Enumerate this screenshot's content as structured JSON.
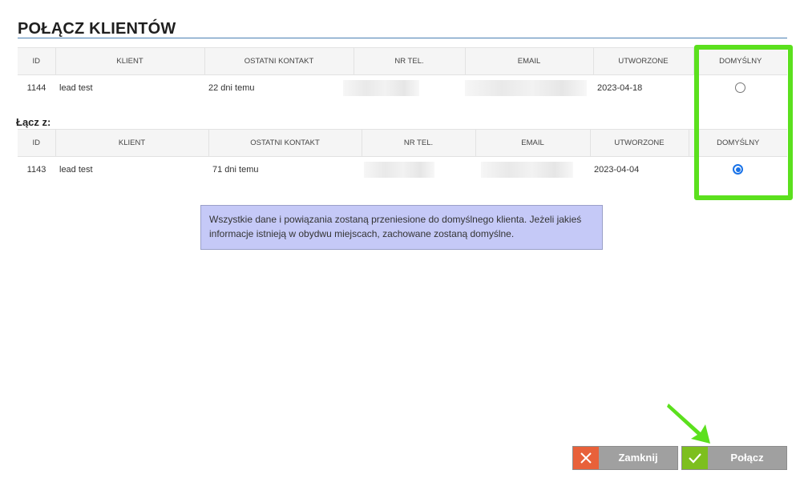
{
  "header": {
    "title": "POŁĄCZ KLIENTÓW"
  },
  "columns": [
    "ID",
    "KLIENT",
    "OSTATNI KONTAKT",
    "NR TEL.",
    "EMAIL",
    "UTWORZONE",
    "DOMYŚLNY"
  ],
  "primary": {
    "id": "1144",
    "client": "lead test",
    "last_contact": "22 dni temu",
    "phone": "",
    "email": "",
    "created": "2023-04-18",
    "default": false
  },
  "merge_section": {
    "label": "Łącz z:",
    "row": {
      "id": "1143",
      "client": "lead test",
      "last_contact": "71 dni temu",
      "phone": "",
      "email": "",
      "created": "2023-04-04",
      "default": true
    }
  },
  "info_message": "Wszystkie dane i powiązania zostaną przeniesione do domyślnego klienta. Jeżeli jakieś informacje istnieją w obydwu miejscach, zachowane zostaną domyślne.",
  "buttons": {
    "close_label": "Zamknij",
    "merge_label": "Połącz"
  },
  "icons": {
    "close": "close-x-icon",
    "merge": "checkmark-icon"
  },
  "colors": {
    "accent_highlight": "#5be01d",
    "radio_selected": "#1a73e8",
    "close_icon_bg": "#e8613a",
    "merge_icon_bg": "#7dbf1e",
    "button_bg": "#a0a0a0",
    "info_bg": "#c5c9f7"
  }
}
